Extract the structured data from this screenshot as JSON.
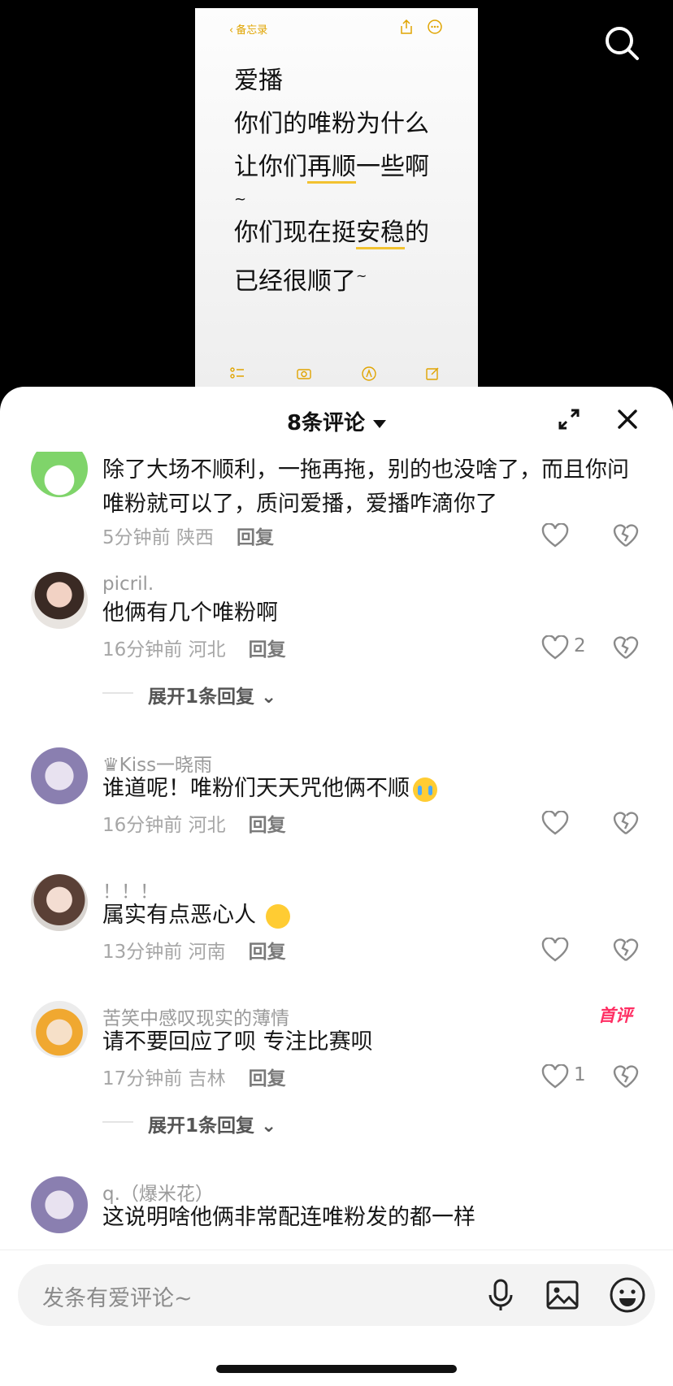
{
  "note": {
    "back_label": "备忘录",
    "title": "爱播",
    "line1": "你们的唯粉为什么",
    "line2_a": "让你们",
    "line2_u": "再顺",
    "line2_b": "一些啊",
    "line3": "~",
    "line4_a": "你们现在挺",
    "line4_u": "安稳",
    "line4_b": "的",
    "line5": "已经很顺了",
    "line5_tilde": "~"
  },
  "sheet": {
    "title": "8条评论"
  },
  "comments": [
    {
      "username": "",
      "text": "除了大场不顺利，一拖再拖，别的也没啥了，而且你问唯粉就可以了，质问爱播，爱播咋滴你了",
      "time": "5分钟前",
      "location": "陕西",
      "reply_label": "回复",
      "likes": ""
    },
    {
      "username": "picril.",
      "text": "他俩有几个唯粉啊",
      "time": "16分钟前",
      "location": "河北",
      "reply_label": "回复",
      "likes": "2",
      "expand": "展开1条回复"
    },
    {
      "username": "♛Kiss一晓雨",
      "text": "谁道呢！唯粉们天天咒他俩不顺",
      "time": "16分钟前",
      "location": "河北",
      "reply_label": "回复",
      "likes": ""
    },
    {
      "username": "！！！",
      "text": "属实有点恶心人",
      "time": "13分钟前",
      "location": "河南",
      "reply_label": "回复",
      "likes": ""
    },
    {
      "username": "苦笑中感叹现实的薄情",
      "badge": "首评",
      "text": "请不要回应了呗 专注比赛呗",
      "time": "17分钟前",
      "location": "吉林",
      "reply_label": "回复",
      "likes": "1",
      "expand": "展开1条回复"
    },
    {
      "username": "q.（爆米花）",
      "text": "这说明啥他俩非常配连唯粉发的都一样",
      "time": "",
      "location": "",
      "reply_label": "",
      "likes": ""
    }
  ],
  "input": {
    "placeholder": "发条有爱评论~"
  },
  "colors": {
    "accent_yellow": "#e0a400",
    "badge_pink": "#ff2e63"
  },
  "icons": [
    "search-icon",
    "share-icon",
    "more-icon",
    "checklist-icon",
    "camera-icon",
    "markup-icon",
    "compose-icon",
    "expand-icon",
    "close-icon",
    "heart-icon",
    "broken-heart-icon",
    "chevron-down-icon",
    "mic-icon",
    "image-icon",
    "emoji-icon"
  ]
}
